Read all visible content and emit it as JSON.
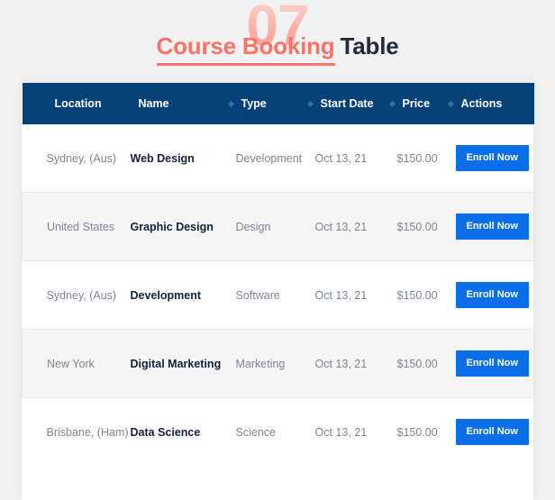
{
  "title": {
    "watermark": "07",
    "accent": "Course Booking",
    "rest": "Table"
  },
  "colors": {
    "page_background": "#f2f2f2",
    "card_background": "#ffffff",
    "header_background": "#064179",
    "accent": "#fa7268",
    "watermark": "#fbb3aa",
    "button": "#0a6ee8",
    "stripe": "#f5f5f5",
    "name_text": "#14213d",
    "muted_text": "#7d8694"
  },
  "table": {
    "columns": [
      {
        "label": "Location",
        "marker": false,
        "key": "location"
      },
      {
        "label": "Name",
        "marker": false,
        "key": "name"
      },
      {
        "label": "Type",
        "marker": true,
        "key": "type"
      },
      {
        "label": "Start Date",
        "marker": true,
        "key": "start_date"
      },
      {
        "label": "Price",
        "marker": true,
        "key": "price"
      },
      {
        "label": "Actions",
        "marker": true,
        "key": "actions"
      }
    ],
    "rows": [
      {
        "location": "Sydney, (Aus)",
        "name": "Web Design",
        "type": "Development",
        "start_date": "Oct 13, 21",
        "price": "$150.00",
        "action_label": "Enroll Now"
      },
      {
        "location": "United States",
        "name": "Graphic Design",
        "type": "Design",
        "start_date": "Oct 13, 21",
        "price": "$150.00",
        "action_label": "Enroll Now"
      },
      {
        "location": "Sydney, (Aus)",
        "name": "Development",
        "type": "Software",
        "start_date": "Oct 13, 21",
        "price": "$150.00",
        "action_label": "Enroll Now"
      },
      {
        "location": "New York",
        "name": "Digital Marketing",
        "type": "Marketing",
        "start_date": "Oct 13, 21",
        "price": "$150.00",
        "action_label": "Enroll Now"
      },
      {
        "location": "Brisbane, (Ham)",
        "name": "Data Science",
        "type": "Science",
        "start_date": "Oct 13, 21",
        "price": "$150.00",
        "action_label": "Enroll Now"
      }
    ]
  }
}
